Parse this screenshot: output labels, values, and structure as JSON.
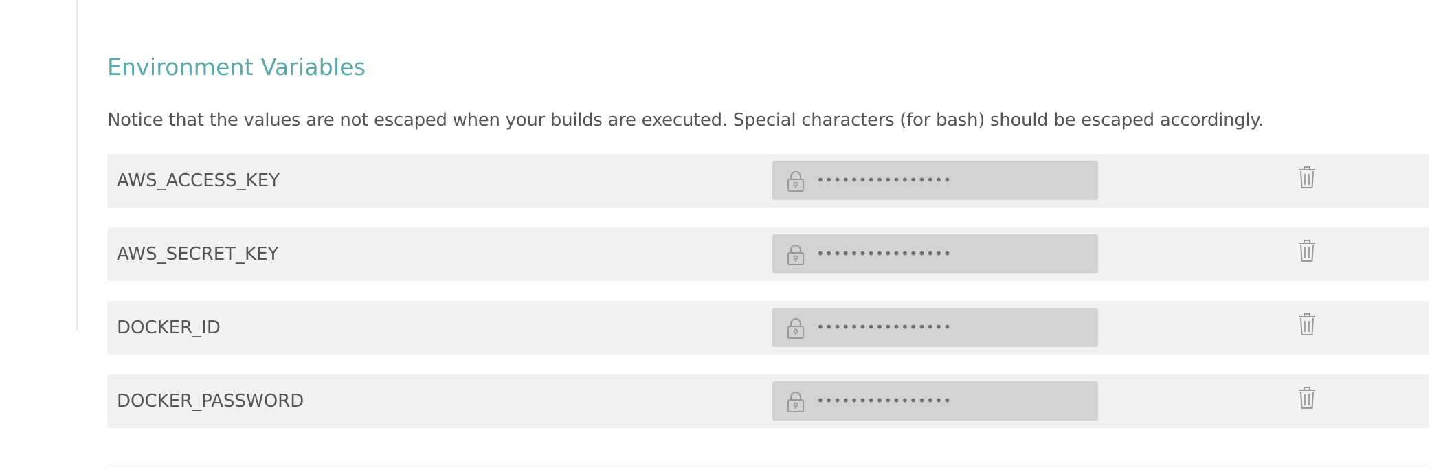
{
  "section": {
    "title": "Environment Variables",
    "notice": "Notice that the values are not escaped when your builds are executed. Special characters (for bash) should be escaped accordingly."
  },
  "colors": {
    "title": "#5aa8a8",
    "text": "#555555",
    "row_bg": "#f1f1f1",
    "value_bg": "#d3d3d3",
    "icon": "#9a9a9a"
  },
  "variables": [
    {
      "name": "AWS_ACCESS_KEY",
      "value_mask": "••••••••••••••••",
      "icons": [
        "lock-icon",
        "trash-icon"
      ]
    },
    {
      "name": "AWS_SECRET_KEY",
      "value_mask": "••••••••••••••••",
      "icons": [
        "lock-icon",
        "trash-icon"
      ]
    },
    {
      "name": "DOCKER_ID",
      "value_mask": "••••••••••••••••",
      "icons": [
        "lock-icon",
        "trash-icon"
      ]
    },
    {
      "name": "DOCKER_PASSWORD",
      "value_mask": "••••••••••••••••",
      "icons": [
        "lock-icon",
        "trash-icon"
      ]
    }
  ]
}
